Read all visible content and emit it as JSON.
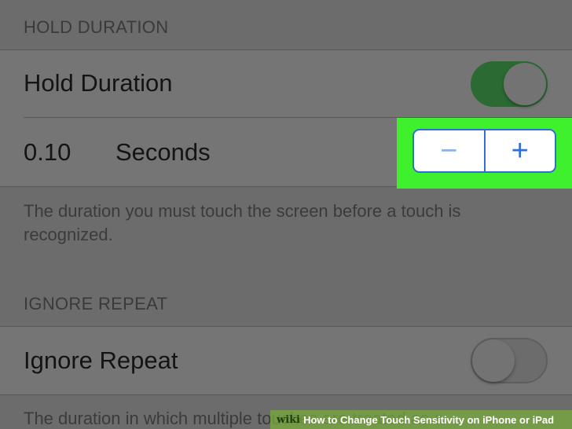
{
  "hold_duration_section": {
    "header": "HOLD DURATION",
    "toggle_label": "Hold Duration",
    "toggle_state": "on",
    "value": "0.10",
    "unit": "Seconds",
    "stepper": {
      "minus_symbol": "−",
      "plus_symbol": "+"
    },
    "footer": "The duration you must touch the screen before a touch is recognized."
  },
  "ignore_repeat_section": {
    "header": "IGNORE REPEAT",
    "toggle_label": "Ignore Repeat",
    "toggle_state": "off",
    "footer": "The duration in which multiple touches are treated as a"
  },
  "watermark": {
    "brand": "wiki",
    "text": "How to Change Touch Sensitivity on iPhone or iPad"
  },
  "colors": {
    "toggle_on": "#2c6a33",
    "stepper_accent": "#2f6fd6",
    "highlight": "#3ff12d"
  }
}
